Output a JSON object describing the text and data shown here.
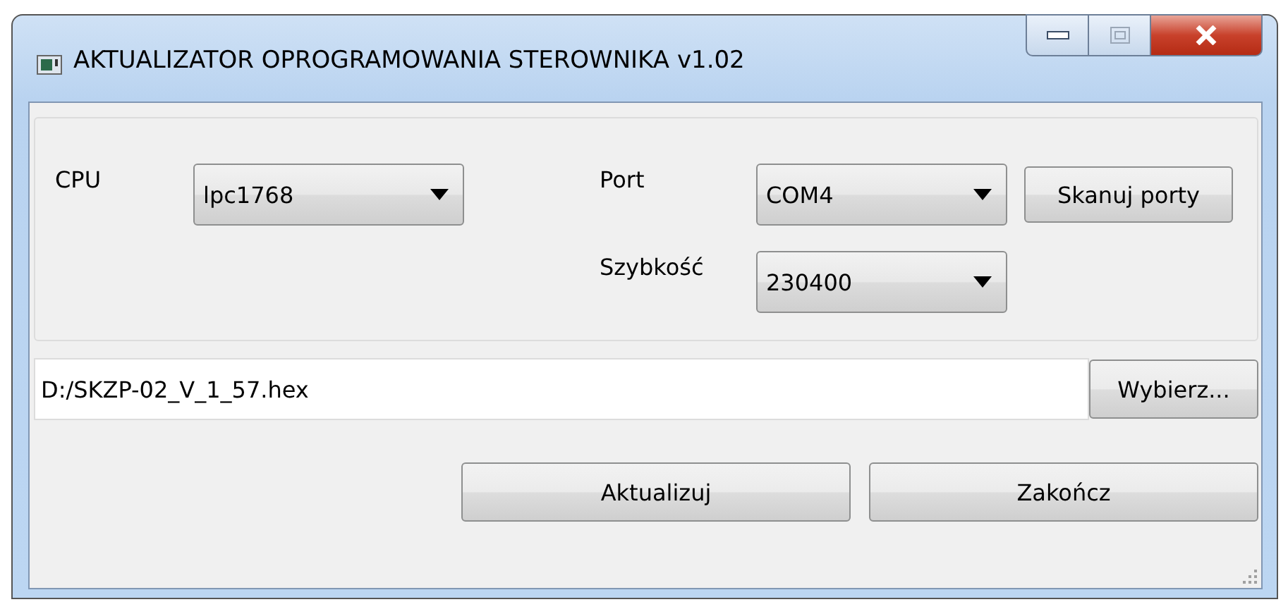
{
  "window": {
    "title": "AKTUALIZATOR OPROGRAMOWANIA STEROWNIKA v1.02"
  },
  "cpu": {
    "label": "CPU",
    "value": "lpc1768"
  },
  "port": {
    "label": "Port",
    "value": "COM4"
  },
  "scan_button": "Skanuj porty",
  "speed": {
    "label": "Szybkość",
    "value": "230400"
  },
  "file": {
    "value": "D:/SKZP-02_V_1_57.hex",
    "browse_button": "Wybierz..."
  },
  "buttons": [
    "Aktualizuj",
    "Zakończ"
  ]
}
